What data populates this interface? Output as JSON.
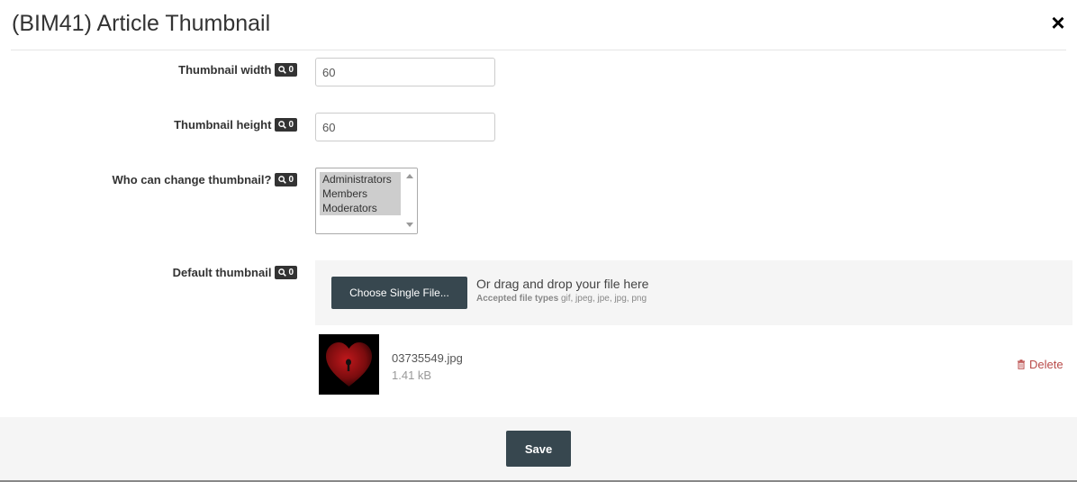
{
  "modal": {
    "title": "(BIM41) Article Thumbnail",
    "close_label": "×"
  },
  "fields": {
    "width": {
      "label": "Thumbnail width",
      "badge_count": "0",
      "value": "60"
    },
    "height": {
      "label": "Thumbnail height",
      "badge_count": "0",
      "value": "60"
    },
    "who_can_change": {
      "label": "Who can change thumbnail?",
      "badge_count": "0",
      "options": [
        "Administrators",
        "Members",
        "Moderators"
      ]
    },
    "default_thumbnail": {
      "label": "Default thumbnail",
      "badge_count": "0",
      "choose_button": "Choose Single File...",
      "drag_text": "Or drag and drop your file here",
      "accepted_label": "Accepted file types",
      "accepted_types": "gif, jpeg, jpe, jpg, png",
      "file": {
        "name": "03735549.jpg",
        "size": "1.41 kB",
        "delete_label": "Delete"
      }
    }
  },
  "footer": {
    "save_label": "Save"
  },
  "icons": {
    "badge": "search-icon",
    "delete": "trash-icon",
    "close": "close-icon"
  },
  "colors": {
    "primary_button": "#37474f",
    "badge": "#333333",
    "delete": "#b94a48",
    "footer_bg": "#f5f5f5"
  }
}
